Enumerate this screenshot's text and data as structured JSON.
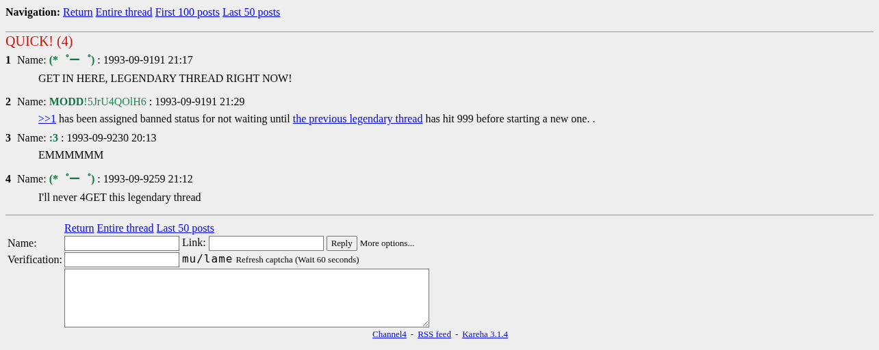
{
  "navigation": {
    "label": "Navigation:",
    "links": [
      "Return",
      "Entire thread",
      "First 100 posts",
      "Last 50 posts"
    ]
  },
  "thread": {
    "title": "QUICK! (4)",
    "posts": [
      {
        "number": "1",
        "name_label": "Name:",
        "name": "(*゜ー゜)",
        "date": ": 1993-09-9191 21:17",
        "body": [
          {
            "kind": "text",
            "text": "GET IN HERE, LEGENDARY THREAD RIGHT NOW!"
          }
        ]
      },
      {
        "number": "2",
        "name_label": "Name:",
        "name": "MODD",
        "trip": "!5JrU4QOlH6",
        "date": ": 1993-09-9191 21:29",
        "body": [
          {
            "kind": "link",
            "text": ">>1"
          },
          {
            "kind": "text",
            "text": " has been assigned banned status for not waiting until "
          },
          {
            "kind": "link",
            "text": "the previous legendary thread"
          },
          {
            "kind": "text",
            "text": " has hit 999 before starting a new one. ."
          }
        ]
      },
      {
        "number": "3",
        "name_label": "Name:",
        "name": ":3",
        "date": ": 1993-09-9230 20:13",
        "body": [
          {
            "kind": "text",
            "text": "EMMMMMM"
          }
        ]
      },
      {
        "number": "4",
        "name_label": "Name:",
        "name": "(*゜ー゜)",
        "date": ": 1993-09-9259 21:12",
        "body": [
          {
            "kind": "text",
            "text": "I'll never 4GET this legendary thread"
          }
        ]
      }
    ]
  },
  "reply_form": {
    "links": [
      "Return",
      "Entire thread",
      "Last 50 posts"
    ],
    "name_label": "Name:",
    "link_label": "Link:",
    "reply_button": "Reply",
    "more_options": "More options...",
    "verification_label": "Verification:",
    "captcha": "mu/lame",
    "refresh": "Refresh captcha (Wait 60 seconds)"
  },
  "footer": {
    "links": [
      "Channel4",
      "RSS feed",
      "Kareha 3.1.4"
    ],
    "separator": "-"
  }
}
